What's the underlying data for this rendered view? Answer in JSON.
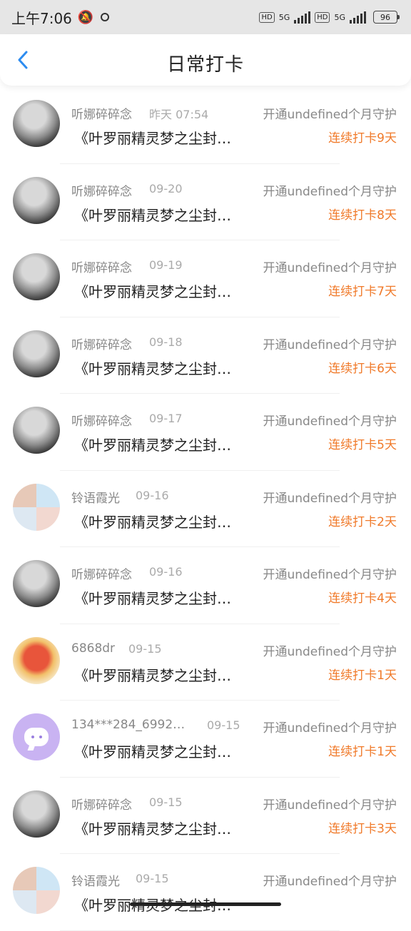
{
  "status_bar": {
    "time": "上午7:06",
    "net1": "5G",
    "net2": "5G",
    "hd": "HD",
    "battery": "96"
  },
  "header": {
    "title": "日常打卡"
  },
  "records": [
    {
      "user": "听娜碎碎念",
      "date": "昨天 07:54",
      "desc": "《叶罗丽精灵梦之尘封…",
      "guard": "开通undefined个月守护",
      "streak": "连续打卡9天",
      "avatar": "gray"
    },
    {
      "user": "听娜碎碎念",
      "date": "09-20",
      "desc": "《叶罗丽精灵梦之尘封…",
      "guard": "开通undefined个月守护",
      "streak": "连续打卡8天",
      "avatar": "gray"
    },
    {
      "user": "听娜碎碎念",
      "date": "09-19",
      "desc": "《叶罗丽精灵梦之尘封…",
      "guard": "开通undefined个月守护",
      "streak": "连续打卡7天",
      "avatar": "gray"
    },
    {
      "user": "听娜碎碎念",
      "date": "09-18",
      "desc": "《叶罗丽精灵梦之尘封…",
      "guard": "开通undefined个月守护",
      "streak": "连续打卡6天",
      "avatar": "gray"
    },
    {
      "user": "听娜碎碎念",
      "date": "09-17",
      "desc": "《叶罗丽精灵梦之尘封…",
      "guard": "开通undefined个月守护",
      "streak": "连续打卡5天",
      "avatar": "gray"
    },
    {
      "user": "铃语霞光",
      "date": "09-16",
      "desc": "《叶罗丽精灵梦之尘封…",
      "guard": "开通undefined个月守护",
      "streak": "连续打卡2天",
      "avatar": "paint"
    },
    {
      "user": "听娜碎碎念",
      "date": "09-16",
      "desc": "《叶罗丽精灵梦之尘封…",
      "guard": "开通undefined个月守护",
      "streak": "连续打卡4天",
      "avatar": "gray"
    },
    {
      "user": "6868dr",
      "date": "09-15",
      "desc": "《叶罗丽精灵梦之尘封…",
      "guard": "开通undefined个月守护",
      "streak": "连续打卡1天",
      "avatar": "koi"
    },
    {
      "user": "134***284_6992…",
      "date": "09-15",
      "desc": "《叶罗丽精灵梦之尘封…",
      "guard": "开通undefined个月守护",
      "streak": "连续打卡1天",
      "avatar": "chat"
    },
    {
      "user": "听娜碎碎念",
      "date": "09-15",
      "desc": "《叶罗丽精灵梦之尘封…",
      "guard": "开通undefined个月守护",
      "streak": "连续打卡3天",
      "avatar": "gray"
    },
    {
      "user": "铃语霞光",
      "date": "09-15",
      "desc": "《叶罗丽精灵梦之尘封…",
      "guard": "开通undefined个月守护",
      "streak": "",
      "avatar": "paint"
    }
  ],
  "colors": {
    "accent": "#f07a2a",
    "back": "#2d8cf0",
    "status_bg": "#e6e6e6"
  }
}
